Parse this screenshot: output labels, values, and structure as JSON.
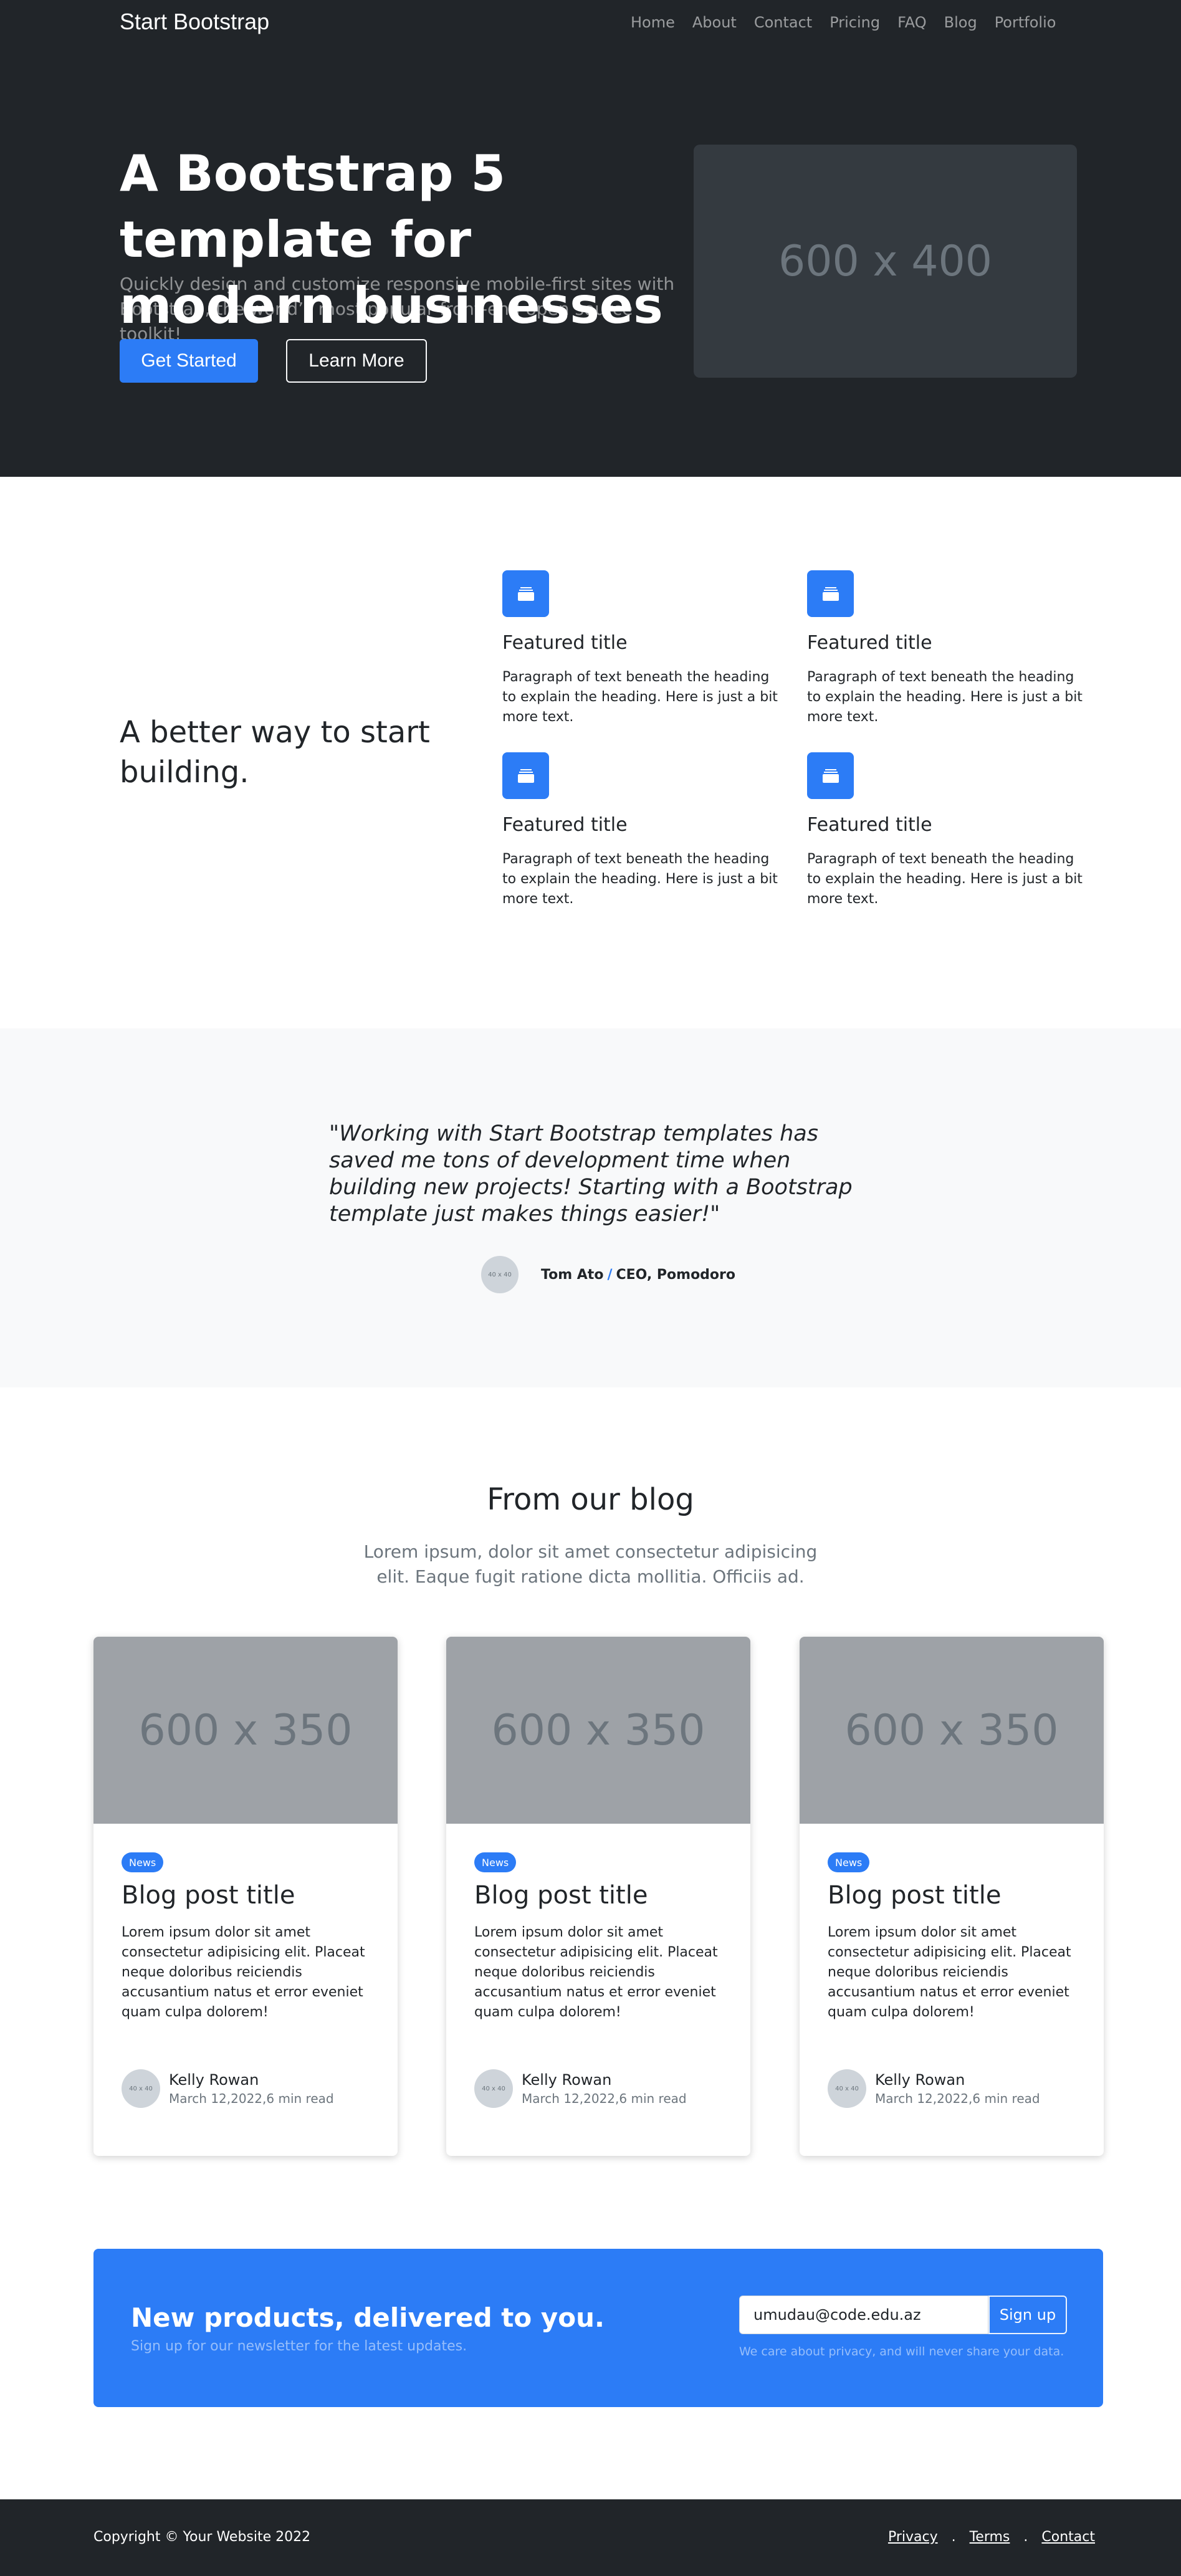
{
  "navbar": {
    "brand": "Start Bootstrap",
    "links": [
      "Home",
      "About",
      "Contact",
      "Pricing",
      "FAQ",
      "Blog",
      "Portfolio"
    ]
  },
  "hero": {
    "title": "A Bootstrap 5 template for modern businesses",
    "lead": "Quickly design and customize responsive mobile-first sites with Bootstrap, the world’s most popular front-end open source toolkit!",
    "primary_button": "Get Started",
    "secondary_button": "Learn More",
    "image_placeholder": "600 x 400"
  },
  "features": {
    "heading": "A better way to start building.",
    "items": [
      {
        "title": "Featured title",
        "text": "Paragraph of text beneath the heading to explain the heading. Here is just a bit more text.",
        "icon": "collection-icon"
      },
      {
        "title": "Featured title",
        "text": "Paragraph of text beneath the heading to explain the heading. Here is just a bit more text.",
        "icon": "collection-icon"
      },
      {
        "title": "Featured title",
        "text": "Paragraph of text beneath the heading to explain the heading. Here is just a bit more text.",
        "icon": "collection-icon"
      },
      {
        "title": "Featured title",
        "text": "Paragraph of text beneath the heading to explain the heading. Here is just a bit more text.",
        "icon": "collection-icon"
      }
    ]
  },
  "testimonial": {
    "quote": "\"Working with Start Bootstrap templates has saved me tons of development time when building new projects! Starting with a Bootstrap template just makes things easier!\"",
    "avatar_placeholder": "40 x 40",
    "author": "Tom Ato",
    "separator": "/",
    "author_title": "CEO, Pomodoro"
  },
  "blog": {
    "title": "From our blog",
    "lead": "Lorem ipsum, dolor sit amet consectetur adipisicing elit. Eaque fugit ratione dicta mollitia. Officiis ad.",
    "cards": [
      {
        "image_placeholder": "600 x 350",
        "badge": "News",
        "title": "Blog post title",
        "text": "Lorem ipsum dolor sit amet consectetur adipisicing elit. Placeat neque doloribus reiciendis accusantium natus et error eveniet quam culpa dolorem!",
        "avatar_placeholder": "40 x 40",
        "author": "Kelly Rowan",
        "meta": "March 12,2022,6 min read"
      },
      {
        "image_placeholder": "600 x 350",
        "badge": "News",
        "title": "Blog post title",
        "text": "Lorem ipsum dolor sit amet consectetur adipisicing elit. Placeat neque doloribus reiciendis accusantium natus et error eveniet quam culpa dolorem!",
        "avatar_placeholder": "40 x 40",
        "author": "Kelly Rowan",
        "meta": "March 12,2022,6 min read"
      },
      {
        "image_placeholder": "600 x 350",
        "badge": "News",
        "title": "Blog post title",
        "text": "Lorem ipsum dolor sit amet consectetur adipisicing elit. Placeat neque doloribus reiciendis accusantium natus et error eveniet quam culpa dolorem!",
        "avatar_placeholder": "40 x 40",
        "author": "Kelly Rowan",
        "meta": "March 12,2022,6 min read"
      }
    ]
  },
  "newsletter": {
    "title": "New products, delivered to you.",
    "subtitle": "Sign up for our newsletter for the latest updates.",
    "email_value": "umudau@code.edu.az",
    "button": "Sign up",
    "note": "We care about privacy, and will never share your data."
  },
  "footer": {
    "copyright": "Copyright © Your Website 2022",
    "links": [
      "Privacy",
      "Terms",
      "Contact"
    ],
    "separator": "."
  },
  "colors": {
    "dark": "#212529",
    "primary": "#2c7cf6",
    "light": "#f8f9fa"
  }
}
